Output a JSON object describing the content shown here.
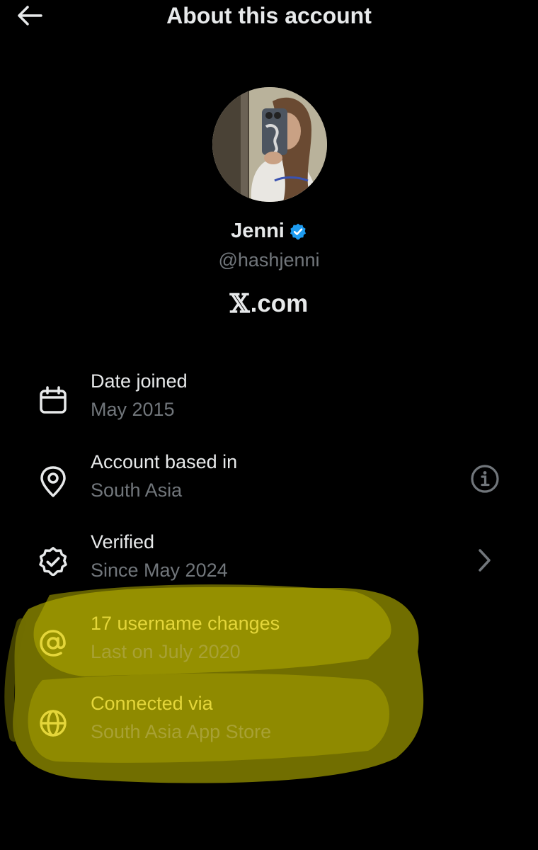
{
  "header": {
    "title": "About this account",
    "back_icon": "back-arrow-icon"
  },
  "profile": {
    "display_name": "Jenni",
    "verified_badge_color": "#1d9bf0",
    "handle": "@hashjenni",
    "platform_mark": "𝕏",
    "platform_suffix": ".com"
  },
  "details": [
    {
      "icon": "calendar-icon",
      "title": "Date joined",
      "subtitle": "May 2015"
    },
    {
      "icon": "location-pin-icon",
      "title": "Account based in",
      "subtitle": "South Asia",
      "action_icon": "info-icon"
    },
    {
      "icon": "verified-icon",
      "title": "Verified",
      "subtitle": "Since May 2024",
      "action_icon": "chevron-right-icon"
    },
    {
      "icon": "at-sign-icon",
      "title": "17 username changes",
      "subtitle": "Last on July 2020",
      "highlighted": true
    },
    {
      "icon": "globe-icon",
      "title": "Connected via",
      "subtitle": "South Asia App Store",
      "highlighted": true
    }
  ],
  "colors": {
    "background": "#000000",
    "primary_text": "#e7e9ea",
    "secondary_text": "#71767b",
    "highlight": "#c8c400"
  }
}
